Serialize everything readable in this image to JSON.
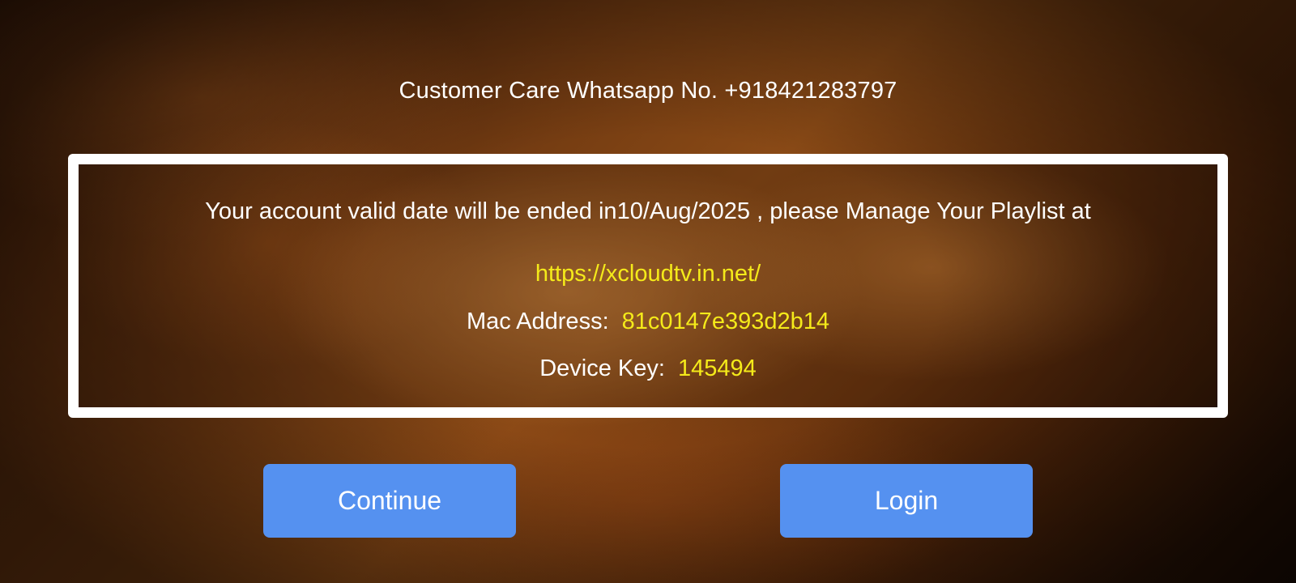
{
  "header": {
    "customer_care": "Customer Care Whatsapp No. +918421283797"
  },
  "notice": {
    "message": "Your account valid date will be ended in10/Aug/2025 , please Manage Your Playlist at",
    "url": "https://xcloudtv.in.net/",
    "mac_label": "Mac Address:",
    "mac_value": "81c0147e393d2b14",
    "key_label": "Device Key:",
    "key_value": "145494"
  },
  "buttons": {
    "continue_label": "Continue",
    "login_label": "Login"
  },
  "colors": {
    "accent_button": "#5591f0",
    "highlight_text": "#f4ea1a",
    "panel_border": "#ffffff"
  }
}
